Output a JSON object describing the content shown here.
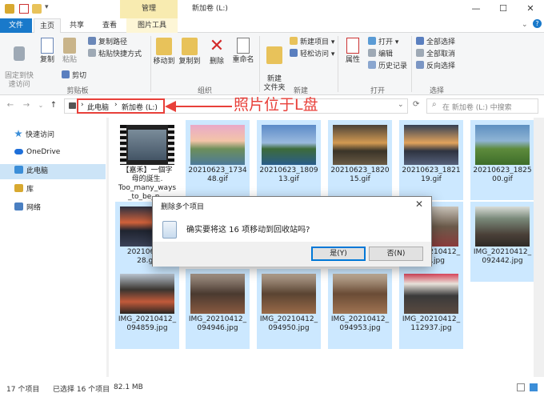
{
  "window": {
    "manage_tab": "管理",
    "title": "新加卷 (L:)",
    "minimize": "—",
    "maximize": "☐",
    "close": "✕"
  },
  "tabs": {
    "file": "文件",
    "home": "主页",
    "share": "共享",
    "view": "查看",
    "picture_tools": "图片工具"
  },
  "ribbon": {
    "pin_quick": "固定到快\n速访问",
    "copy": "复制",
    "paste": "粘贴",
    "copy_path": "复制路径",
    "paste_shortcut": "粘贴快捷方式",
    "cut": "剪切",
    "clipboard": "剪贴板",
    "move_to": "移动到",
    "copy_to": "复制到",
    "delete": "删除",
    "rename": "重命名",
    "organize": "组织",
    "new_folder": "新建\n文件夹",
    "new_item": "新建项目 ▾",
    "easy_access": "轻松访问 ▾",
    "new": "新建",
    "properties": "属性",
    "open": "打开 ▾",
    "edit": "编辑",
    "history": "历史记录",
    "open_group": "打开",
    "select_all": "全部选择",
    "select_none": "全部取消",
    "invert": "反向选择",
    "select": "选择"
  },
  "address": {
    "crumb_pc": "此电脑",
    "crumb_drive": "新加卷 (L:)",
    "search_placeholder": "在 新加卷 (L:) 中搜索",
    "annotation": "照片位于L盘"
  },
  "sidebar": {
    "items": [
      {
        "label": "快速访问"
      },
      {
        "label": "OneDrive"
      },
      {
        "label": "此电脑"
      },
      {
        "label": "库"
      },
      {
        "label": "网络"
      }
    ]
  },
  "files": [
    {
      "name": "【嘉禾】一個字\n母的誕生.\nToo_many_ways\n_to_be_n..."
    },
    {
      "name": "20210623_1734\n48.gif"
    },
    {
      "name": "20210623_1809\n13.gif"
    },
    {
      "name": "20210623_1820\n15.gif"
    },
    {
      "name": "20210623_1821\n19.gif"
    },
    {
      "name": "20210623_1825\n00.gif"
    },
    {
      "name": "20210623_\n28.gif"
    },
    {
      "name": "IMG_20210412_\n089.jpg"
    },
    {
      "name": "IMG_20210412_\n092442.jpg"
    },
    {
      "name": "IMG_20210412_\n094859.jpg"
    },
    {
      "name": "IMG_20210412_\n094946.jpg"
    },
    {
      "name": "IMG_20210412_\n094950.jpg"
    },
    {
      "name": "IMG_20210412_\n094953.jpg"
    },
    {
      "name": "IMG_20210412_\n112937.jpg"
    }
  ],
  "dialog": {
    "title": "删除多个项目",
    "close": "✕",
    "message": "确实要将这 16 项移动到回收站吗?",
    "yes": "是(Y)",
    "no": "否(N)"
  },
  "status": {
    "count": "17 个项目",
    "selected": "已选择 16 个项目",
    "size": "82.1 MB"
  }
}
